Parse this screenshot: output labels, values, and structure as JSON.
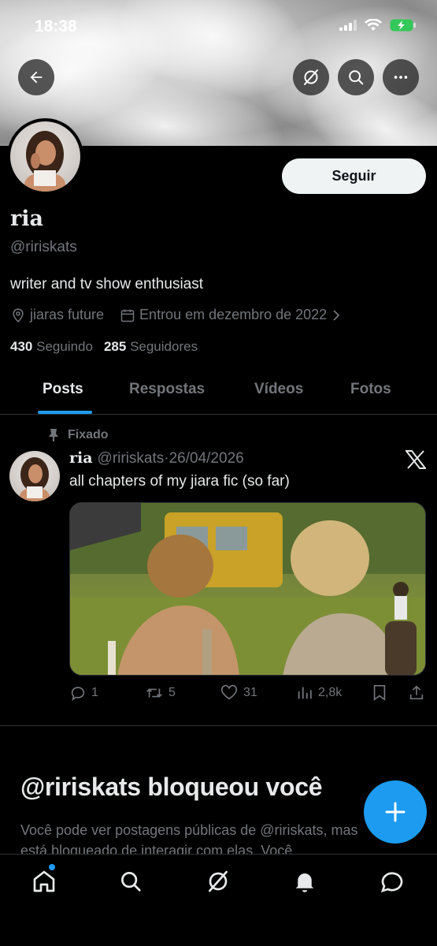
{
  "status_bar": {
    "time": "18:38"
  },
  "profile": {
    "name": "ria",
    "handle": "@ririskats",
    "bio": "writer and tv show enthusiast",
    "location": "jiaras future",
    "joined": "Entrou em dezembro de 2022",
    "following_count": "430",
    "following_label": "Seguindo",
    "followers_count": "285",
    "followers_label": "Seguidores",
    "follow_button": "Seguir"
  },
  "tabs": [
    {
      "label": "Posts",
      "active": true
    },
    {
      "label": "Respostas",
      "active": false
    },
    {
      "label": "Vídeos",
      "active": false
    },
    {
      "label": "Fotos",
      "active": false
    }
  ],
  "pinned_post": {
    "pinned_label": "Fixado",
    "author_name": "ria",
    "author_handle": "@ririskats",
    "date": "·26/04/2026",
    "text": "all chapters of my jiara fic (so far)",
    "replies": "1",
    "reposts": "5",
    "likes": "31",
    "views": "2,8k"
  },
  "blocked_notice": {
    "title": "@ririskats bloqueou você",
    "text": "Você pode ver postagens públicas de @ririskats, mas está bloqueado de interagir com elas. Você"
  },
  "colors": {
    "accent": "#1d9bf0",
    "muted": "#71767b",
    "text": "#e7e9ea",
    "border": "#2f3336"
  },
  "icons": {
    "top_bar": [
      "back-arrow-icon",
      "grok-icon",
      "search-icon",
      "more-icon"
    ],
    "bottom_nav": [
      "home-icon",
      "search-icon",
      "grok-icon",
      "notifications-icon",
      "messages-icon"
    ]
  }
}
